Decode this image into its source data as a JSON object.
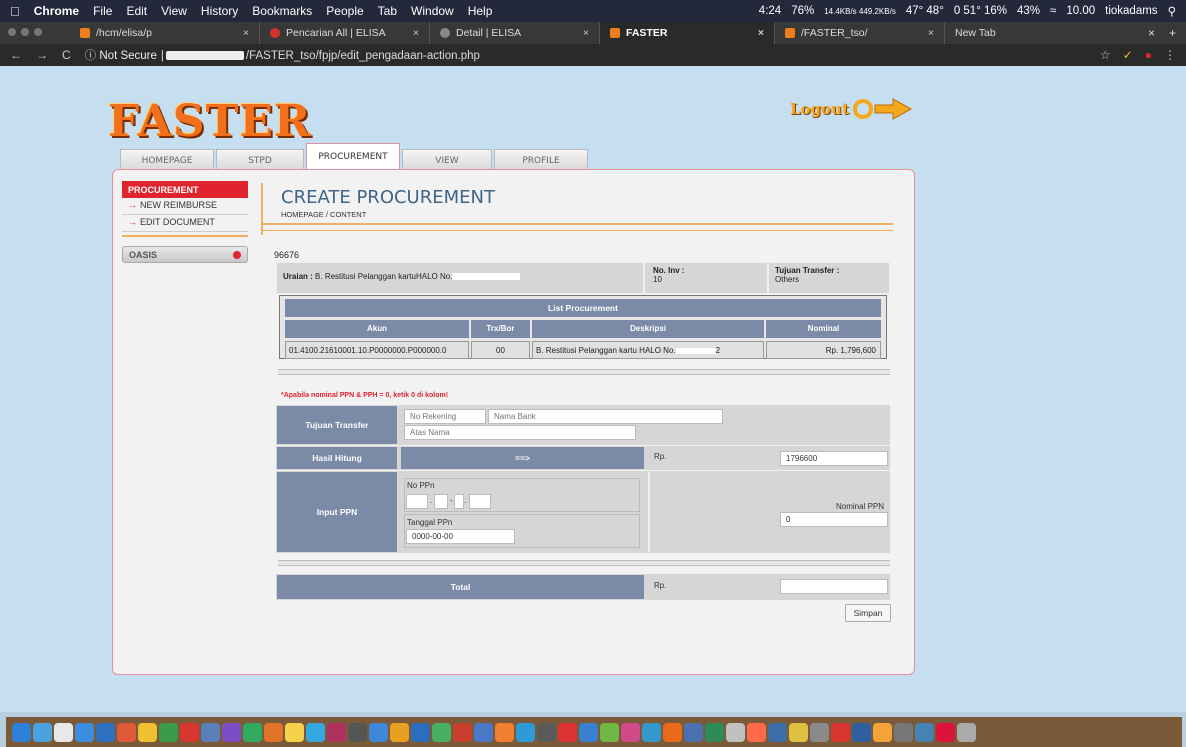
{
  "os_menubar": {
    "app_name": "Chrome",
    "items": [
      "File",
      "Edit",
      "View",
      "History",
      "Bookmarks",
      "People",
      "Tab",
      "Window",
      "Help"
    ],
    "status": {
      "time_left": "4:24",
      "battery_a": "76%",
      "net": "14.4KB/s 449.2KB/s",
      "temps": "47° 48°",
      "misc": "0  51°  16%",
      "battery_b": "43%",
      "clock": "10.00",
      "user": "tiokadams"
    }
  },
  "browser": {
    "tabs": [
      {
        "label": "/hcm/elisa/p",
        "active": false
      },
      {
        "label": "Pencarian All | ELISA",
        "active": false
      },
      {
        "label": "Detail | ELISA",
        "active": false
      },
      {
        "label": "FASTER",
        "active": true
      },
      {
        "label": "/FASTER_tso/",
        "active": false
      },
      {
        "label": "New Tab",
        "active": false
      }
    ],
    "address": {
      "not_secure": "Not Secure",
      "url": "/FASTER_tso/fpjp/edit_pengadaan-action.php"
    }
  },
  "site": {
    "logo": "FASTER",
    "logout": "Logout",
    "nav_tabs": [
      {
        "label": "HOMEPAGE",
        "active": false
      },
      {
        "label": "STPD",
        "active": false
      },
      {
        "label": "PROCUREMENT",
        "active": true
      },
      {
        "label": "VIEW",
        "active": false
      },
      {
        "label": "PROFILE",
        "active": false
      }
    ],
    "sidebar": {
      "header": "PROCUREMENT",
      "items": [
        "NEW REIMBURSE",
        "EDIT DOCUMENT"
      ],
      "oasis": "OASIS"
    },
    "content": {
      "title": "CREATE PROCUREMENT",
      "breadcrumb": "HOMEPAGE / CONTENT",
      "doc_number": "96676",
      "uraian_label": "Uraian :",
      "uraian_value": "B. Restitusi Pelanggan kartuHALO No.",
      "no_inv_label": "No. Inv :",
      "no_inv_value": "10",
      "tujuan_label": "Tujuan Transfer :",
      "tujuan_value": "Others",
      "list": {
        "title": "List Procurement",
        "headers": [
          "Akun",
          "Trx/Bor",
          "Deskripsi",
          "Nominal"
        ],
        "rows": [
          [
            "01.4100.21610001.10.P0000000.P000000.0",
            "00",
            "B. Restitusi Pelanggan kartu HALO No.",
            "2",
            "Rp. 1,796,600"
          ]
        ]
      },
      "warning": "*Apabila nominal PPN & PPH = 0, ketik 0 di kolom!",
      "form": {
        "tujuan_transfer_label": "Tujuan Transfer",
        "no_rekening_placeholder": "No Rekening",
        "nama_bank_placeholder": "Nama Bank",
        "atas_nama_placeholder": "Atas Nama",
        "hasil_hitung_label": "Hasil Hitung",
        "arrow": "==>",
        "rp": "Rp.",
        "hasil_value": "1796600",
        "input_ppn_label": "Input PPN",
        "no_ppn_label": "No PPn",
        "dash": "-",
        "dot": ".",
        "tanggal_ppn_label": "Tanggal PPn",
        "tanggal_ppn_value": "0000-00-00",
        "nominal_ppn_label": "Nominal PPN",
        "nominal_ppn_value": "0",
        "total_label": "Total",
        "total_value": ""
      },
      "save_button": "Simpan"
    }
  },
  "colors": {
    "accent": "#e0232c",
    "header_bg": "#7b8aa6",
    "logo": "#f2701c",
    "page_bg": "#c5def0"
  }
}
